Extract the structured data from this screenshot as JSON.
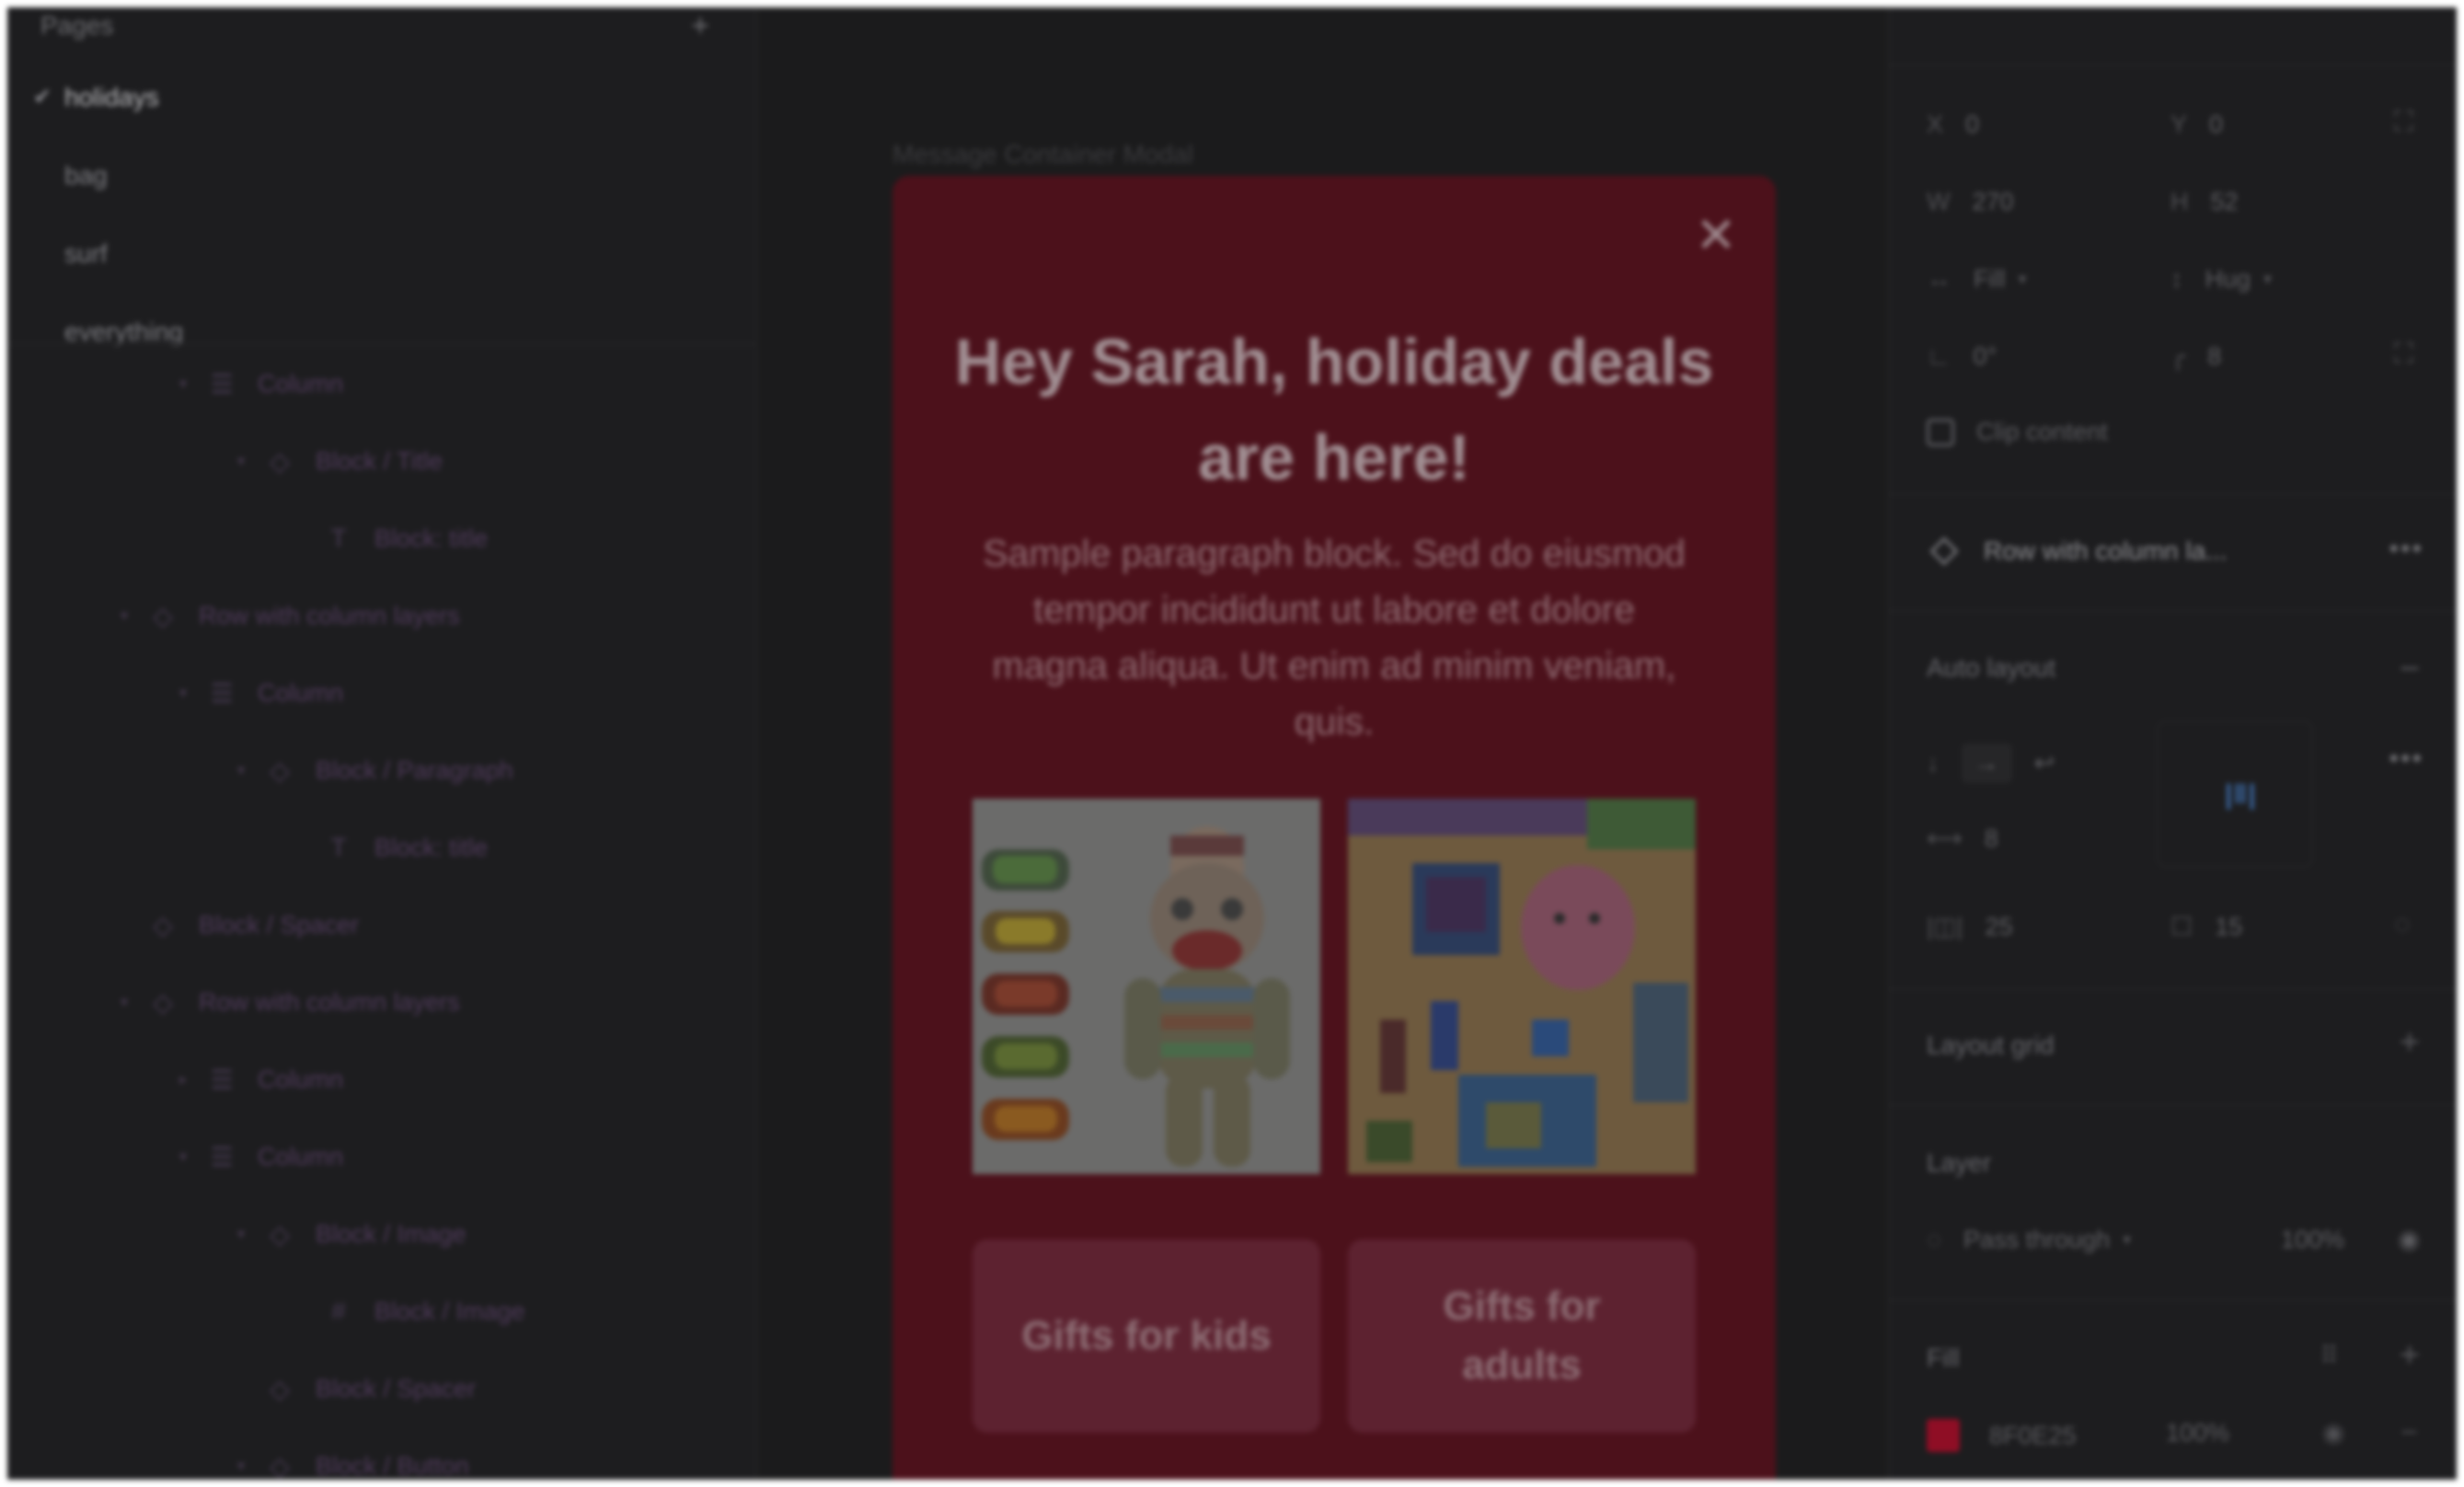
{
  "pages": {
    "title": "Pages",
    "add_icon": "plus-icon",
    "items": [
      {
        "label": "holidays",
        "active": true
      },
      {
        "label": "bag",
        "active": false
      },
      {
        "label": "surf",
        "active": false
      },
      {
        "label": "everything",
        "active": false
      }
    ]
  },
  "layers": [
    {
      "label": "Column",
      "icon": "column-icon"
    },
    {
      "label": "Block / Title",
      "icon": "component-icon"
    },
    {
      "label": "Block: title",
      "icon": "text-icon"
    },
    {
      "label": "Row with column layers",
      "icon": "component-icon"
    },
    {
      "label": "Column",
      "icon": "column-icon"
    },
    {
      "label": "Block / Paragraph",
      "icon": "component-icon"
    },
    {
      "label": "Block: title",
      "icon": "text-icon"
    },
    {
      "label": "Block / Spacer",
      "icon": "component-icon"
    },
    {
      "label": "Row with column layers",
      "icon": "component-icon"
    },
    {
      "label": "Column",
      "icon": "column-icon"
    },
    {
      "label": "Column",
      "icon": "column-icon"
    },
    {
      "label": "Block / Image",
      "icon": "component-icon"
    },
    {
      "label": "Block / Image",
      "icon": "frame-icon"
    },
    {
      "label": "Block / Spacer",
      "icon": "component-icon"
    },
    {
      "label": "Block / Button",
      "icon": "component-icon"
    }
  ],
  "canvas": {
    "frame_label": "Message Container Modal",
    "modal": {
      "close_icon": "close-icon",
      "title": "Hey Sarah, holiday deals are here!",
      "paragraph": "Sample paragraph block. Sed do eiusmod tempor incididunt ut labore et dolore magna aliqua. Ut enim ad minim veniam, quis.",
      "image_left": "sock-monkey-and-toy-cars-image",
      "image_right": "toys-flatlay-image",
      "button_left": "Gifts for kids",
      "button_right": "Gifts for adults",
      "bg_color": "#4c111b"
    }
  },
  "inspector": {
    "x_label": "X",
    "x_value": "0",
    "y_label": "Y",
    "y_value": "0",
    "w_label": "W",
    "w_value": "270",
    "h_label": "H",
    "h_value": "52",
    "width_mode": "Fill",
    "height_mode": "Hug",
    "rotation": "0°",
    "radius": "8",
    "clip_content": "Clip content",
    "component_name": "Row with column la...",
    "auto_layout_title": "Auto layout",
    "gap": "8",
    "padding_h": "25",
    "padding_v": "15",
    "layout_grid_title": "Layout grid",
    "layer_title": "Layer",
    "blend_mode": "Pass through",
    "layer_opacity": "100%",
    "fill_title": "Fill",
    "fill_hex": "8F0E25",
    "fill_opacity": "100%",
    "fill_color": "#8f0e25"
  }
}
